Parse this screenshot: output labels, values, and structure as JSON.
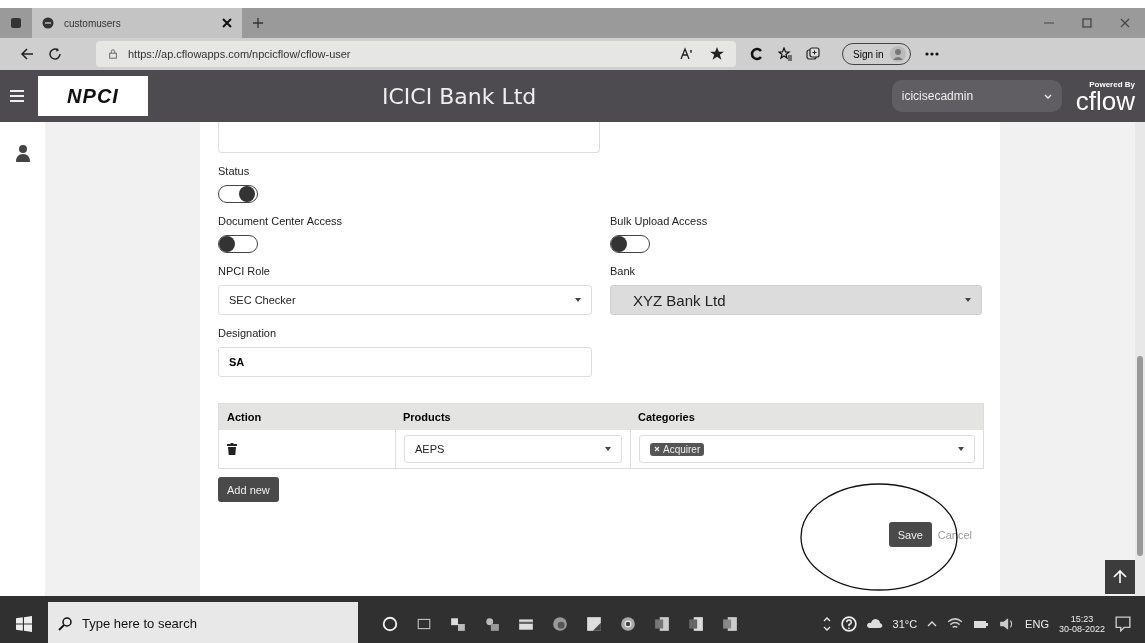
{
  "browser": {
    "tab": {
      "title": "customusers"
    },
    "url": "https://ap.cflowapps.com/npcicflow/cflow-user",
    "sign_in": "Sign in"
  },
  "header": {
    "logo": "NPCI",
    "title": "ICICI Bank Ltd",
    "user": "icicisecadmin",
    "powered_by": "Powered By",
    "brand": "cflow"
  },
  "form": {
    "toggles": [
      {
        "label": "Status",
        "on": true
      },
      {
        "label": "Document Center Access",
        "on": false
      },
      {
        "label": "Bulk Upload Access",
        "on": false
      }
    ],
    "npci_role": {
      "label": "NPCI Role",
      "value": "SEC Checker",
      "disabled": false
    },
    "bank": {
      "label": "Bank",
      "value": "XYZ Bank Ltd",
      "disabled": true
    },
    "designation": {
      "label": "Designation",
      "value": "SA"
    },
    "table": {
      "columns": [
        "Action",
        "Products",
        "Categories"
      ],
      "rows": [
        {
          "product": "AEPS",
          "categories": [
            "Acquirer"
          ]
        }
      ]
    },
    "add_button": "Add new",
    "save_button": "Save",
    "cancel_link": "Cancel"
  },
  "taskbar": {
    "search": {
      "placeholder": "Type here to search"
    },
    "weather": "31°C",
    "language": "ENG",
    "time": "15:23",
    "date": "30-08-2022"
  }
}
